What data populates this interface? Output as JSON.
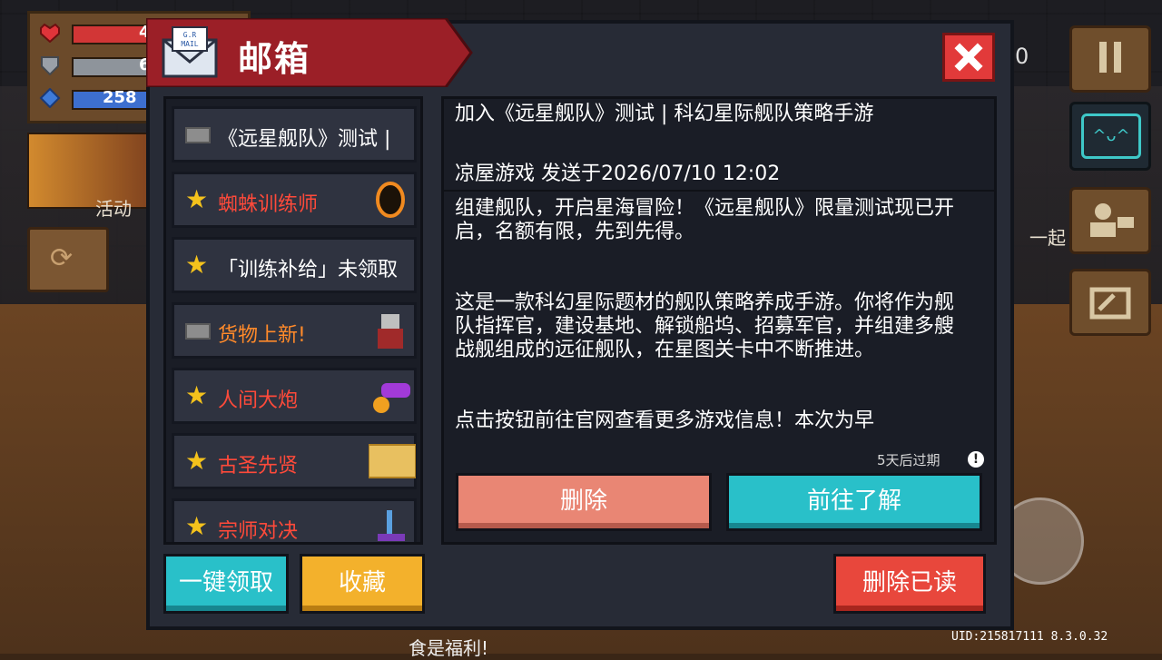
{
  "hud": {
    "hp_value": "4",
    "armor_value": "6",
    "energy_value": "258",
    "activity_label": "活动",
    "side_counter": "0",
    "together_label": "一起",
    "bottom_banner": "食是福利!",
    "uid": "UID:215817111 8.3.0.32"
  },
  "dialog": {
    "title": "邮箱",
    "mail_icon_text": "G.R MAIL"
  },
  "mail_list": [
    {
      "label": "《远星舰队》测试 |",
      "icon": "envelope-icon",
      "color": "#ffffff",
      "thumb": "none"
    },
    {
      "label": "蜘蛛训练师",
      "icon": "star-icon",
      "color": "#ff4a3a",
      "thumb": "spider-portal-icon"
    },
    {
      "label": "「训练补给」未领取",
      "icon": "star-icon",
      "color": "#ffffff",
      "thumb": "none"
    },
    {
      "label": "货物上新!",
      "icon": "envelope-icon",
      "color": "#ff8a2a",
      "thumb": "merchant-icon"
    },
    {
      "label": "人间大炮",
      "icon": "star-icon",
      "color": "#ff4a3a",
      "thumb": "cannon-icon"
    },
    {
      "label": "古圣先贤",
      "icon": "star-icon",
      "color": "#ff4a3a",
      "thumb": "scroll-icon"
    },
    {
      "label": "宗师对决",
      "icon": "star-icon",
      "color": "#ff4a3a",
      "thumb": "sword-icon"
    }
  ],
  "detail": {
    "subject": "加入《远星舰队》测试 | 科幻星际舰队策略手游",
    "sender_line": "凉屋游戏 发送于2026/07/10 12:02",
    "paragraphs": [
      "组建舰队，开启星海冒险！《远星舰队》限量测试现已开启，名额有限，先到先得。",
      "这是一款科幻星际题材的舰队策略养成手游。你将作为舰队指挥官，建设基地、解锁船坞、招募军官，并组建多艘战舰组成的远征舰队，在星图关卡中不断推进。",
      "点击按钮前往官网查看更多游戏信息！本次为早"
    ],
    "expire_text": "5天后过期",
    "expire_icon": "!"
  },
  "buttons": {
    "delete": "删除",
    "learn_more": "前往了解",
    "claim_all": "一键领取",
    "favorite": "收藏",
    "delete_read": "删除已读"
  },
  "colors": {
    "title_red": "#9b1f27",
    "close_red": "#e23a3a",
    "star_yellow": "#f4c21c",
    "delete_salmon": "#e98674",
    "learn_cyan": "#29c0c9",
    "favorite_gold": "#f3b12c",
    "delete_read_red": "#e8473c"
  }
}
